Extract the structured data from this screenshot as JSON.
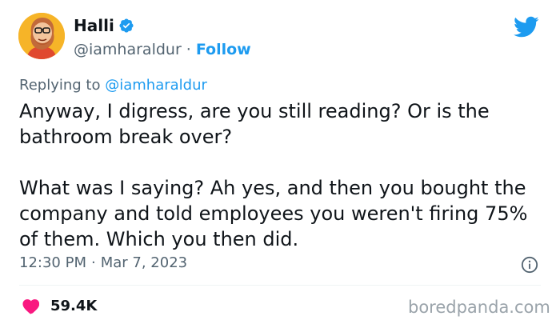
{
  "author": {
    "name": "Halli",
    "handle": "@iamharaldur",
    "separator": "·",
    "follow_label": "Follow"
  },
  "reply": {
    "prefix": "Replying to",
    "handle": "@iamharaldur"
  },
  "tweet": {
    "text": "Anyway, I digress, are you still reading? Or is the bathroom break over?\n\nWhat was I saying? Ah yes, and then you bought the company and told employees you weren't firing 75% of them. Which you then did."
  },
  "meta": {
    "time": "12:30 PM",
    "separator": "·",
    "date": "Mar 7, 2023"
  },
  "engagement": {
    "likes": "59.4K"
  },
  "watermark": "boredpanda.com",
  "icons": {
    "avatar": "cartoon-avatar",
    "verified": "verified-badge-icon",
    "brand": "twitter-bird-icon",
    "info": "info-icon",
    "like": "heart-icon"
  },
  "colors": {
    "accent": "#1d9bf0",
    "heart": "#f91880",
    "secondary_text": "#536471",
    "avatar_bg": "#f6b428"
  }
}
